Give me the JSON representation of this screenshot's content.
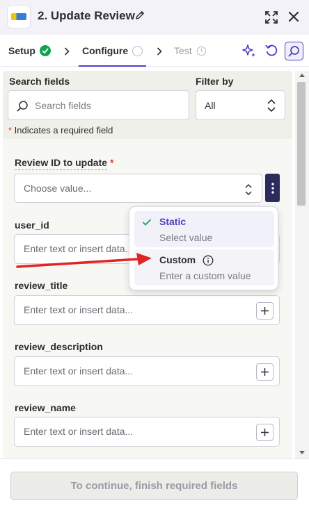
{
  "header": {
    "title": "2. Update Review",
    "app_logo": "app-logo-icon",
    "icons": [
      "edit-icon",
      "expand-icon",
      "close-icon"
    ]
  },
  "tabs": [
    {
      "label": "Setup",
      "status": "complete"
    },
    {
      "label": "Configure",
      "status": "active"
    },
    {
      "label": "Test",
      "status": "pending"
    }
  ],
  "toolbar": {
    "icons": [
      "sparkle-icon",
      "undo-icon",
      "search-icon"
    ]
  },
  "search": {
    "label": "Search fields",
    "placeholder": "Search fields",
    "filter_label": "Filter by",
    "filter_value": "All"
  },
  "required_note": {
    "star": "*",
    "text": " Indicates a required field"
  },
  "fields": [
    {
      "label": "Review ID to update",
      "required": true,
      "placeholder": "Choose value..."
    },
    {
      "label": "user_id",
      "placeholder": "Enter text or insert data..."
    },
    {
      "label": "review_title",
      "placeholder": "Enter text or insert data..."
    },
    {
      "label": "review_description",
      "placeholder": "Enter text or insert data..."
    },
    {
      "label": "review_name",
      "placeholder": "Enter text or insert data..."
    }
  ],
  "dropdown": {
    "options": [
      {
        "title": "Static",
        "subtitle": "Select value",
        "selected": true
      },
      {
        "title": "Custom",
        "subtitle": "Enter a custom value",
        "selected": false
      }
    ]
  },
  "footer": {
    "button_label": "To continue, finish required fields"
  },
  "colors": {
    "accent": "#503ebe",
    "success": "#13a34f",
    "required": "#d93a2b",
    "annotation_arrow": "#e02424"
  }
}
